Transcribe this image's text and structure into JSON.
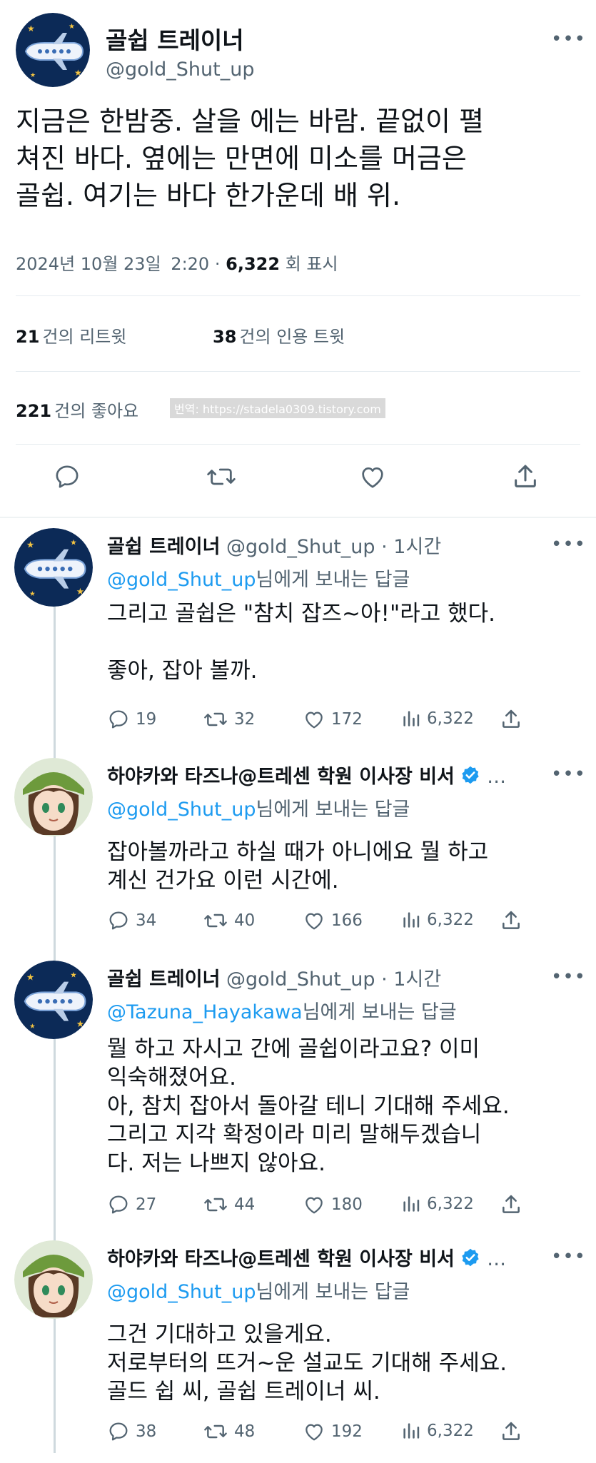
{
  "main_tweet": {
    "name": "골쉽 트레이너",
    "handle": "@gold_Shut_up",
    "text_lines": [
      "지금은 한밤중. 살을 에는 바람. 끝없이 펼",
      "쳐진 바다. 옆에는 만면에 미소를 머금은",
      "골쉽. 여기는 바다 한가운데 배 위."
    ],
    "date": "2024년 10월 23일",
    "time": "2:20",
    "dot": "·",
    "views": "6,322",
    "views_label": "회 표시",
    "retweets": "21",
    "retweets_label": "건의 리트윗",
    "quotes": "38",
    "quotes_label": "건의 인용 트윗",
    "likes": "221",
    "likes_label": "건의 좋아요",
    "watermark": "번역: https://stadela0309.tistory.com",
    "more": "•••"
  },
  "replies": [
    {
      "name": "골쉽 트레이너",
      "handle": "@gold_Shut_up",
      "time": "· 1시간",
      "to_handle": "@gold_Shut_up",
      "to_suffix": "님에게 보내는 답글",
      "lines": [
        "그리고 골쉽은 \"참치 잡즈~아!\"라고 했다.",
        "",
        "좋아, 잡아 볼까."
      ],
      "comments": "19",
      "retweets": "32",
      "likes": "172",
      "views": "6,322"
    },
    {
      "name": "하야카와 타즈나@트레센 학원 이사장 비서",
      "handle": "",
      "time": "…",
      "to_handle": "@gold_Shut_up",
      "to_suffix": "님에게 보내는 답글",
      "lines": [
        "잡아볼까라고 하실 때가 아니에요 뭘 하고",
        "계신 건가요 이런 시간에."
      ],
      "comments": "34",
      "retweets": "40",
      "likes": "166",
      "views": "6,322"
    },
    {
      "name": "골쉽 트레이너",
      "handle": "@gold_Shut_up",
      "time": "· 1시간",
      "to_handle": "@Tazuna_Hayakawa",
      "to_suffix": "님에게 보내는 답글",
      "lines": [
        "뭘 하고 자시고 간에 골쉽이라고요? 이미",
        "익숙해졌어요.",
        "아, 참치 잡아서 돌아갈 테니 기대해 주세요.",
        "그리고 지각 확정이라 미리 말해두겠습니",
        "다. 저는 나쁘지 않아요."
      ],
      "comments": "27",
      "retweets": "44",
      "likes": "180",
      "views": "6,322"
    },
    {
      "name": "하야카와 타즈나@트레센 학원 이사장 비서",
      "handle": "",
      "time": "…",
      "to_handle": "@gold_Shut_up",
      "to_suffix": "님에게 보내는 답글",
      "lines": [
        "그건 기대하고 있을게요.",
        "저로부터의 뜨거~운 설교도 기대해 주세요.",
        "골드 쉽 씨, 골쉽 트레이너 씨."
      ],
      "comments": "38",
      "retweets": "48",
      "likes": "192",
      "views": "6,322"
    }
  ],
  "colors": {
    "accent": "#1d9bf0",
    "text": "#0f1419",
    "muted": "#536471",
    "night": "#0c2a57"
  },
  "icons": [
    "airplane-avatar-icon",
    "girl-avatar-icon",
    "reply-icon",
    "retweet-icon",
    "like-icon",
    "share-icon",
    "views-icon",
    "verified-badge-icon"
  ]
}
